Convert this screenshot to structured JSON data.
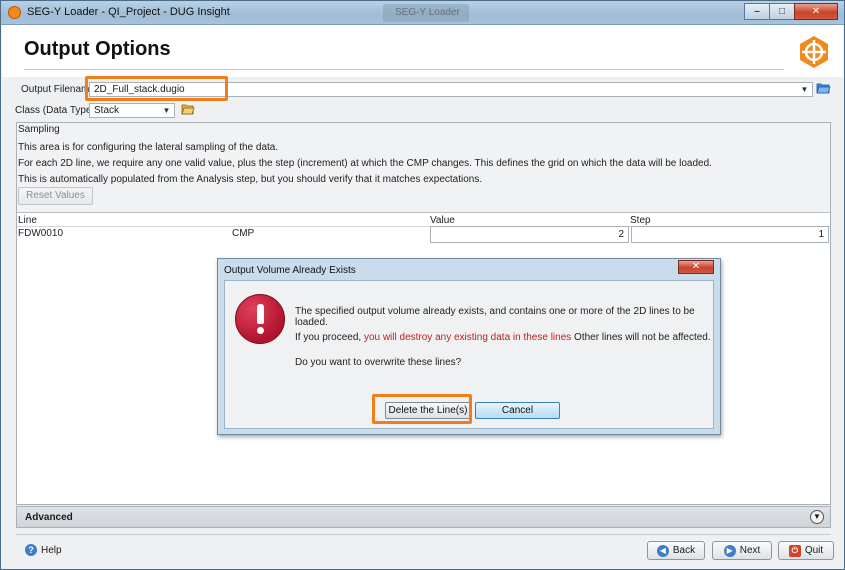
{
  "window": {
    "title": "SEG-Y Loader - QI_Project - DUG Insight",
    "background_tab_label": "SEG-Y Loader",
    "controls": [
      "–",
      "□",
      "✕"
    ]
  },
  "header": {
    "title": "Output Options",
    "logo_icon": "dug-crosshair-logo-icon"
  },
  "form": {
    "output_filename_label": "Output Filename",
    "output_filename_value": "2D_Full_stack.dugio",
    "class_label": "Class (Data Type)",
    "class_value": "Stack"
  },
  "sampling": {
    "title": "Sampling",
    "lines": [
      "This area is for configuring the lateral sampling of the data.",
      "For each 2D line, we require any one valid value, plus the step (increment) at which the CMP changes.  This defines the grid on which the data will be loaded.",
      "This is automatically populated from the Analysis step, but you should verify that it matches expectations."
    ],
    "reset_button": "Reset Values",
    "table": {
      "headers": [
        "Line",
        "",
        "Value",
        "Step"
      ],
      "rows": [
        {
          "line": "FDW0010",
          "type": "CMP",
          "value": "2",
          "step": "1"
        }
      ]
    }
  },
  "advanced": {
    "label": "Advanced"
  },
  "footer": {
    "help": "Help",
    "back": "Back",
    "next": "Next",
    "quit": "Quit"
  },
  "dialog": {
    "title": "Output Volume Already Exists",
    "close": "✕",
    "message1": "The specified output volume already exists, and contains one or more of the 2D lines to be loaded.",
    "message2_prefix": "If you proceed, ",
    "message2_red": "you will destroy any existing data in these lines",
    "message2_suffix": " Other lines will not be affected.",
    "message3": "Do you want to overwrite these lines?",
    "delete_button": "Delete the Line(s)",
    "cancel_button": "Cancel"
  },
  "colors": {
    "highlight": "#f07f1a",
    "warning_text": "#c0201f",
    "brand_orange": "#f08a1c"
  }
}
